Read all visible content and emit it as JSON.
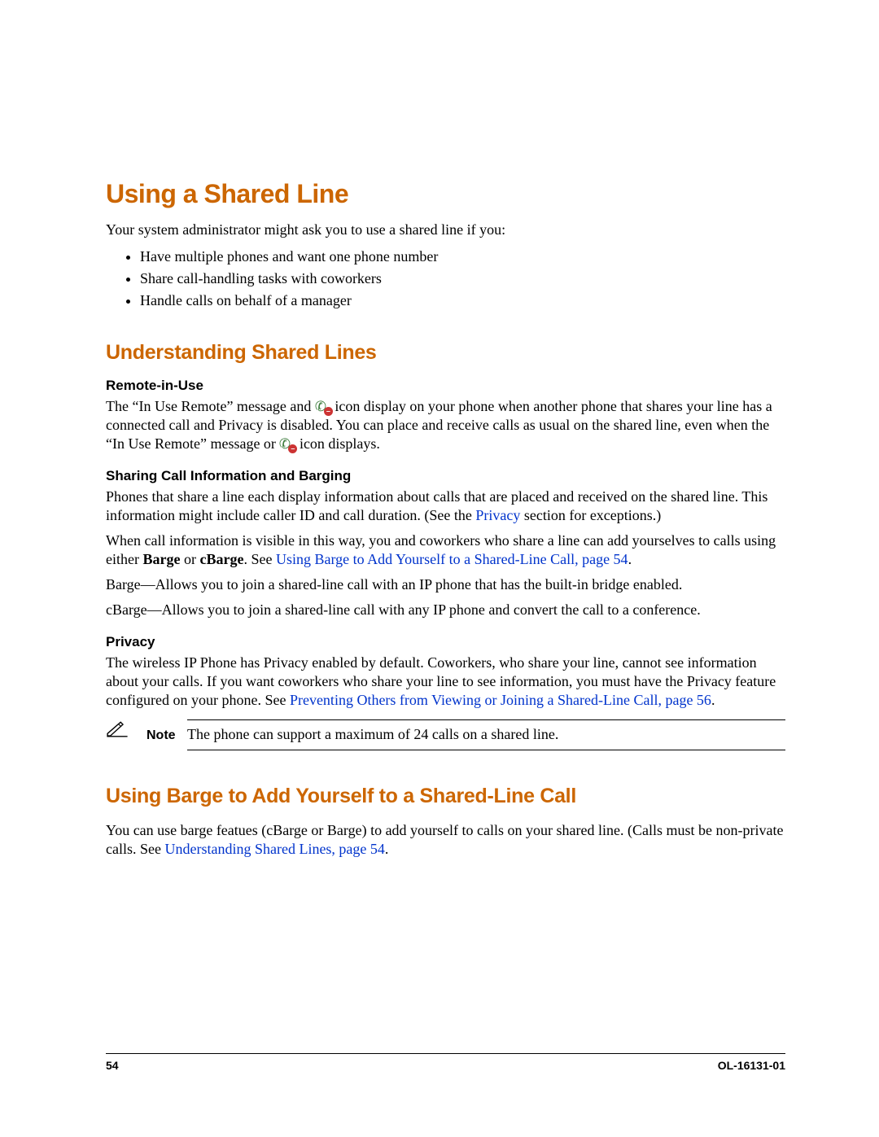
{
  "h1": "Using a Shared Line",
  "intro": "Your system administrator might ask you to use a shared line if you:",
  "bullets": [
    "Have multiple phones and want one phone number",
    "Share call-handling tasks with coworkers",
    "Handle calls on behalf of a manager"
  ],
  "h2a": "Understanding Shared Lines",
  "remote": {
    "heading": "Remote-in-Use",
    "p_a": "The “In Use Remote” message and ",
    "p_b": " icon display on your phone when another phone that shares your line has a connected call and Privacy is disabled. You can place and receive calls as usual on the shared line, even when the “In Use Remote” message or ",
    "p_c": " icon displays."
  },
  "sharing": {
    "heading": "Sharing Call Information and Barging",
    "p1_a": "Phones that share a line each display information about calls that are placed and received on the shared line. This information might include caller ID and call duration. (See the ",
    "p1_link": "Privacy",
    "p1_b": " section for exceptions.)",
    "p2_a": "When call information is visible in this way, you and coworkers who share a line can add yourselves to calls using either ",
    "p2_b1": "Barge",
    "p2_or": " or ",
    "p2_b2": "cBarge",
    "p2_c": ". See ",
    "p2_link": "Using Barge to Add Yourself to a Shared-Line Call, page 54",
    "p2_d": ".",
    "p3": "Barge—Allows you to join a shared-line call with an IP phone that has the built-in bridge enabled.",
    "p4": "cBarge—Allows you to join a shared-line call with any IP phone and convert the call to a conference."
  },
  "privacy": {
    "heading": "Privacy",
    "p_a": "The wireless IP Phone has Privacy enabled by default. Coworkers, who share your line, cannot see information about your calls. If you want coworkers who share your line to see information, you must have the Privacy feature configured on your phone. See ",
    "p_link": "Preventing Others from Viewing or Joining a Shared-Line Call, page 56",
    "p_b": "."
  },
  "note": {
    "label": "Note",
    "text": "The phone can support a maximum of 24 calls on a shared line."
  },
  "h2b": "Using Barge to Add Yourself to a Shared-Line Call",
  "barge": {
    "p_a": "You can use barge featues (cBarge or Barge) to add yourself to calls on your shared line. (Calls must be non-private calls. See ",
    "p_link": "Understanding Shared Lines, page 54",
    "p_b": "."
  },
  "footer": {
    "page": "54",
    "docnum": "OL-16131-01"
  }
}
